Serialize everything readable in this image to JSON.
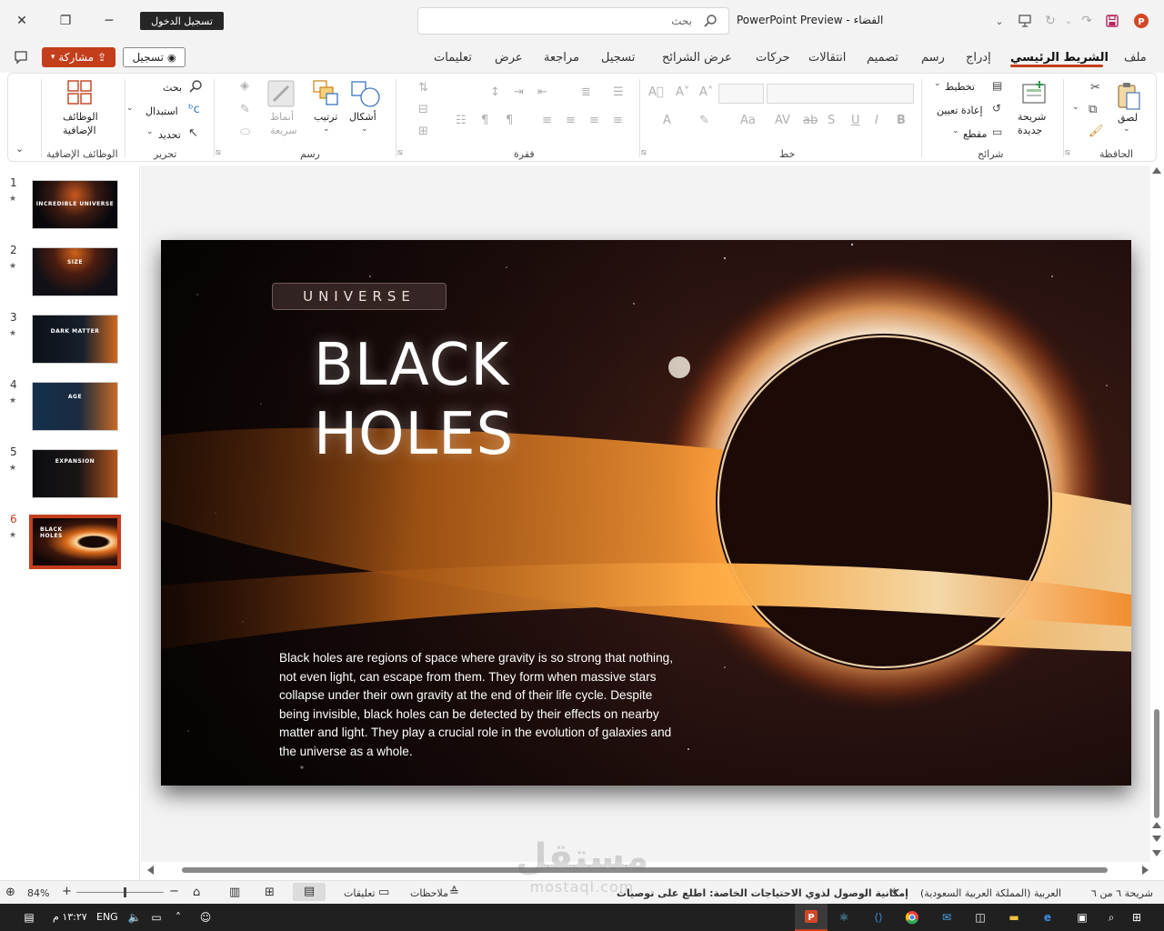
{
  "titlebar": {
    "signin": "تسجيل الدخول",
    "search_placeholder": "بحث",
    "doc_title": "PowerPoint Preview  -  الفضاء"
  },
  "tabs": [
    "ملف",
    "الشريط الرئيسي",
    "إدراج",
    "رسم",
    "تصميم",
    "انتقالات",
    "حركات",
    "عرض الشرائح",
    "تسجيل",
    "مراجعة",
    "عرض",
    "تعليمات"
  ],
  "active_tab": "الشريط الرئيسي",
  "share_label": "مشاركة",
  "record_label": "تسجيل",
  "ribbon": {
    "clipboard": {
      "label": "الحافظة",
      "paste": "لصق"
    },
    "slides": {
      "label": "شرائح",
      "new_slide_1": "شريحة",
      "new_slide_2": "جديدة",
      "layout": "تخطيط",
      "reset": "إعادة تعيين",
      "section": "مقطع"
    },
    "font": {
      "label": "خط"
    },
    "paragraph": {
      "label": "فقرة"
    },
    "drawing": {
      "label": "رسم",
      "shapes": "أشكال",
      "arrange": "ترتيب",
      "quick_styles_1": "أنماط",
      "quick_styles_2": "سريعة"
    },
    "editing": {
      "label": "تحرير",
      "find": "بحث",
      "replace": "استبدال",
      "select": "تحديد"
    },
    "addins": {
      "label": "الوظائف الإضافية",
      "btn_1": "الوظائف",
      "btn_2": "الإضافية"
    }
  },
  "thumbnails": [
    {
      "num": "1",
      "title": "INCREDIBLE UNIVERSE"
    },
    {
      "num": "2",
      "title": "SIZE"
    },
    {
      "num": "3",
      "title": "DARK MATTER"
    },
    {
      "num": "4",
      "title": "AGE"
    },
    {
      "num": "5",
      "title": "EXPANSION"
    },
    {
      "num": "6",
      "title": "BLACK HOLES"
    }
  ],
  "slide": {
    "kicker": "UNIVERSE",
    "title_line1": "BLACK",
    "title_line2": "HOLES",
    "body": "Black holes are regions of space where gravity is so strong that nothing, not even light, can escape from them. They form when massive stars collapse under their own gravity at the end of their life cycle. Despite being invisible, black holes can be detected by their effects on nearby matter and light. They play a crucial role in the evolution of galaxies and the universe as a whole."
  },
  "status": {
    "slide_of": "شريحة ٦ من ٦",
    "language": "العربية (المملكة العربية السعودية)",
    "accessibility": "إمكانية الوصول لذوي الاحتياجات الخاصة: اطلع على توصيات",
    "notes": "ملاحظات",
    "comments": "تعليقات",
    "zoom": "84%"
  },
  "taskbar": {
    "time": "١٣:٢٧ م",
    "lang": "ENG"
  },
  "watermark": {
    "line1": "مستقل",
    "line2": "mostaql.com"
  },
  "colors": {
    "accent": "#c43e1c",
    "taskbar": "#202020",
    "chrome": "#f3f3f3"
  }
}
